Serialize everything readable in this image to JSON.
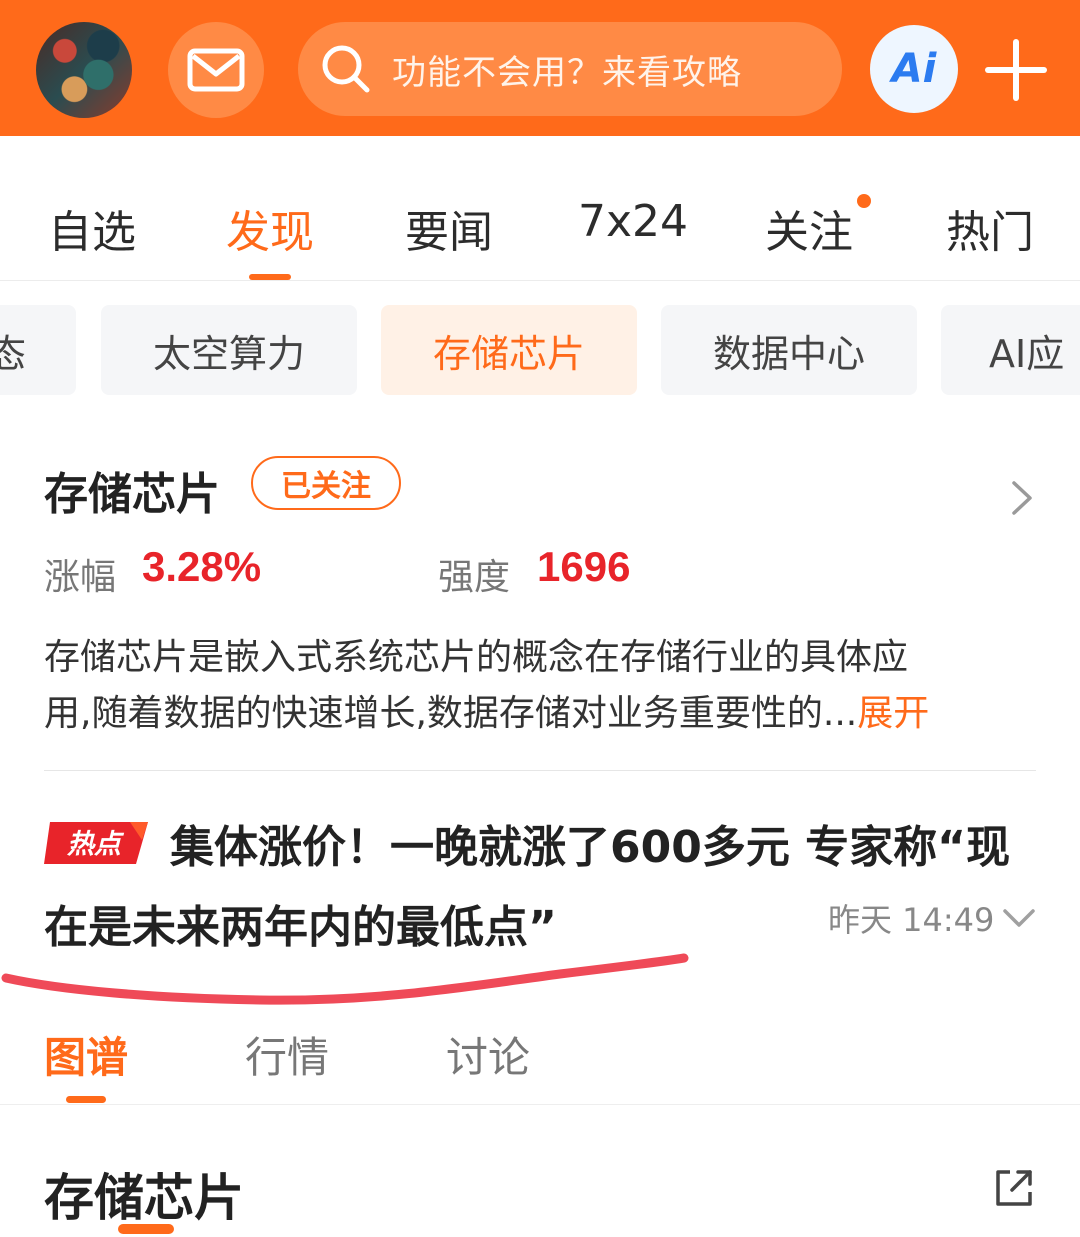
{
  "header": {
    "search_placeholder": "功能不会用？来看攻略",
    "ai_label": "Ai",
    "brand_color": "#ff6a1a",
    "icons": [
      "avatar",
      "mail-icon",
      "search-icon",
      "ai-icon",
      "plus-icon"
    ]
  },
  "main_tabs": [
    {
      "label": "自选",
      "active": false
    },
    {
      "label": "发现",
      "active": true
    },
    {
      "label": "要闻",
      "active": false
    },
    {
      "label": "7x24",
      "active": false
    },
    {
      "label": "关注",
      "active": false,
      "has_dot": true
    },
    {
      "label": "热门",
      "active": false
    }
  ],
  "chips": [
    {
      "label": "态",
      "active": false
    },
    {
      "label": "太空算力",
      "active": false
    },
    {
      "label": "存储芯片",
      "active": true
    },
    {
      "label": "数据中心",
      "active": false
    },
    {
      "label": "AI应",
      "active": false
    }
  ],
  "topic": {
    "title": "存储芯片",
    "follow_label": "已关注",
    "change_label": "涨幅",
    "change_value": "3.28%",
    "strength_label": "强度",
    "strength_value": "1696",
    "description_line1": "存储芯片是嵌入式系统芯片的概念在存储行业的具体应",
    "description_line2": "用,随着数据的快速增长,数据存储对业务重要性的...",
    "expand_label": "展开"
  },
  "news": {
    "badge": "热点",
    "title_line1": "集体涨价！一晚就涨了600多元 专家称“现",
    "title_line2": "在是未来两年内的最低点”",
    "time": "昨天 14:49"
  },
  "sub_tabs": [
    {
      "label": "图谱",
      "active": true
    },
    {
      "label": "行情",
      "active": false
    },
    {
      "label": "讨论",
      "active": false
    }
  ],
  "section": {
    "title": "存储芯片"
  }
}
